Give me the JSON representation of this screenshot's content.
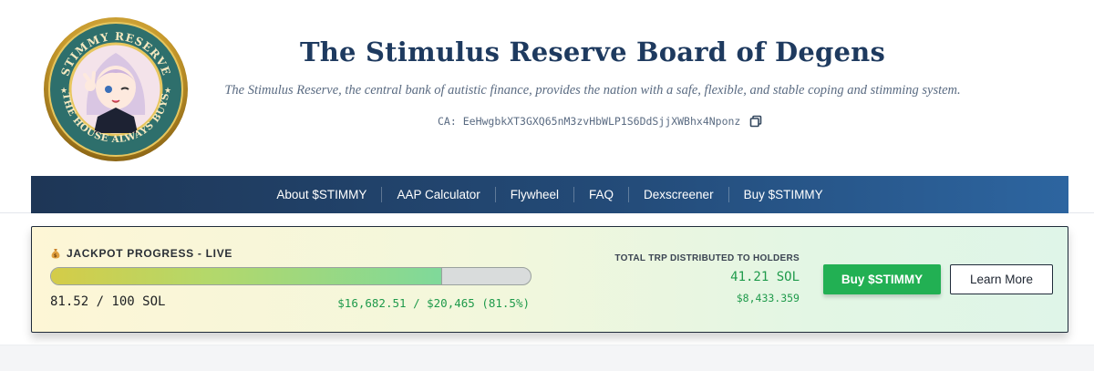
{
  "header": {
    "logo_top_text": "STIMMY RESERVE",
    "logo_bottom_text": "THE HOUSE ALWAYS BUYS",
    "title": "The Stimulus Reserve Board of Degens",
    "tagline": "The Stimulus Reserve, the central bank of autistic finance, provides the nation with a safe, flexible, and stable coping and stimming system.",
    "ca_label": "CA:",
    "ca_value": "EeHwgbkXT3GXQ65nM3zvHbWLP1S6DdSjjXWBhx4Nponz",
    "copy_icon": "copy-icon"
  },
  "nav": {
    "items": [
      {
        "label": "About $STIMMY"
      },
      {
        "label": "AAP Calculator"
      },
      {
        "label": "Flywheel"
      },
      {
        "label": "FAQ"
      },
      {
        "label": "Dexscreener"
      },
      {
        "label": "Buy $STIMMY"
      }
    ]
  },
  "jackpot": {
    "icon": "money-bag-icon",
    "title": "JACKPOT PROGRESS - LIVE",
    "progress_fraction": 0.815,
    "sol_progress": "81.52 / 100 SOL",
    "usd_progress": "$16,682.51 / $20,465 (81.5%)",
    "trp_label": "TOTAL TRP DISTRIBUTED TO HOLDERS",
    "trp_sol": "41.21 SOL",
    "trp_usd": "$8,433.359",
    "buy_label": "Buy $STIMMY",
    "learn_label": "Learn More"
  },
  "colors": {
    "nav_start": "#1e3656",
    "nav_end": "#2d65a0",
    "accent_green": "#22b053",
    "value_green": "#1f9a4b",
    "title_navy": "#1e3a5f"
  }
}
